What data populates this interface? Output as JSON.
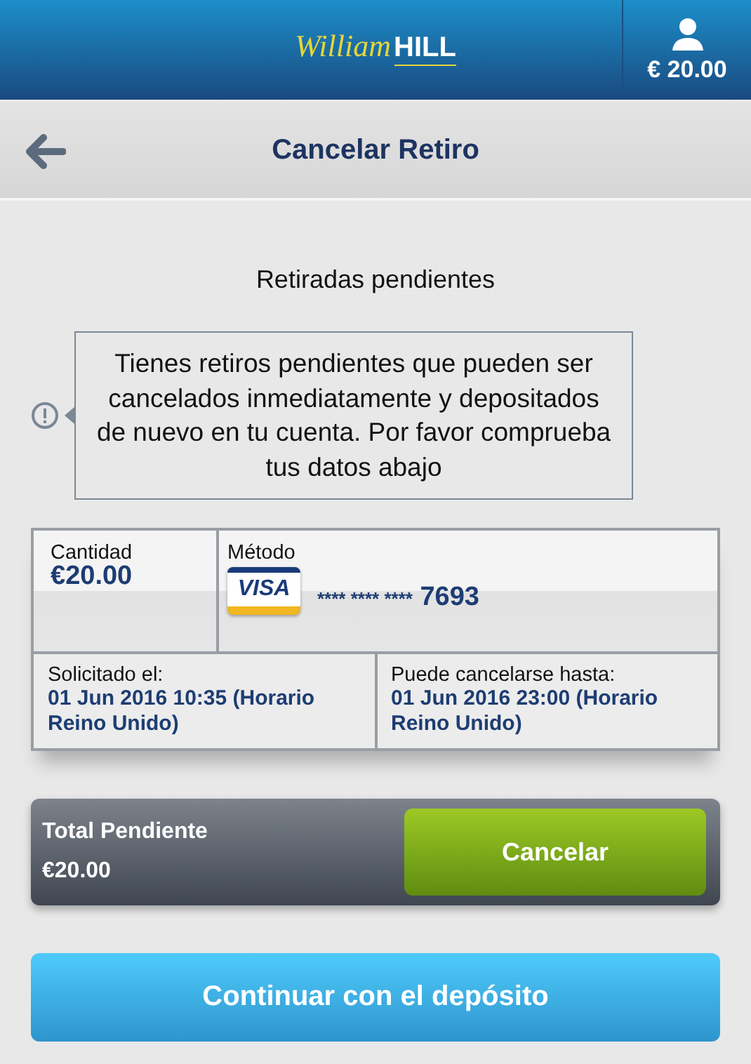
{
  "header": {
    "logo": {
      "script": "William",
      "bold": "HILL"
    },
    "balance": "€ 20.00"
  },
  "page": {
    "title": "Cancelar Retiro"
  },
  "section_title": "Retiradas pendientes",
  "notice": "Tienes retiros pendientes que pueden ser cancelados inmediatamente y depositados de nuevo en tu cuenta. Por favor comprueba tus datos abajo",
  "withdrawal": {
    "amount_label": "Cantidad",
    "amount": "€20.00",
    "method_label": "Método",
    "card_brand": "VISA",
    "card_number": "**** **** ****",
    "card_last": "7693",
    "requested_label": "Solicitado el:",
    "requested": "01 Jun 2016 10:35 (Horario Reino Unido)",
    "cancel_until_label": "Puede cancelarse hasta:",
    "cancel_until": "01 Jun 2016 23:00 (Horario Reino Unido)"
  },
  "total": {
    "label": "Total Pendiente",
    "amount": "€20.00",
    "button": "Cancelar"
  },
  "continue_button": "Continuar con el depósito"
}
